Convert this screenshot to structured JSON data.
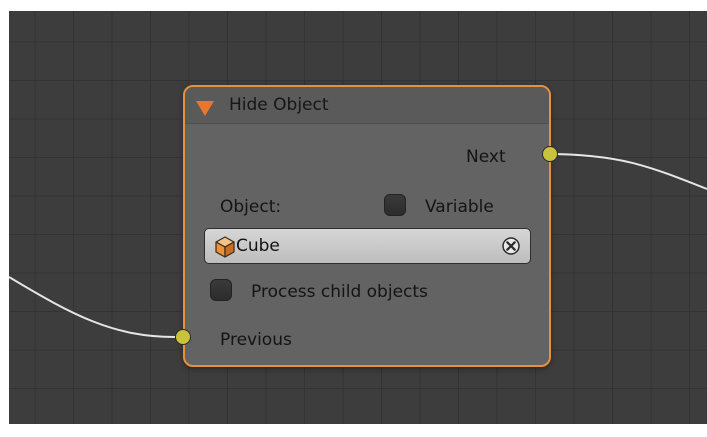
{
  "node": {
    "title": "Hide Object",
    "output_next_label": "Next",
    "object_label": "Object:",
    "variable_label": "Variable",
    "object_field_value": "Cube",
    "process_children_label": "Process child objects",
    "input_previous_label": "Previous"
  },
  "colors": {
    "node_border": "#e8913b",
    "collapse_arrow": "#e8772e",
    "socket_fill": "#c9c23b",
    "link_curve": "#e6e6e6",
    "canvas_background": "#3d3d3d"
  },
  "icons": {
    "collapse": "triangle-down-icon",
    "object_field": "cube-icon",
    "clear": "x-circle-icon"
  }
}
